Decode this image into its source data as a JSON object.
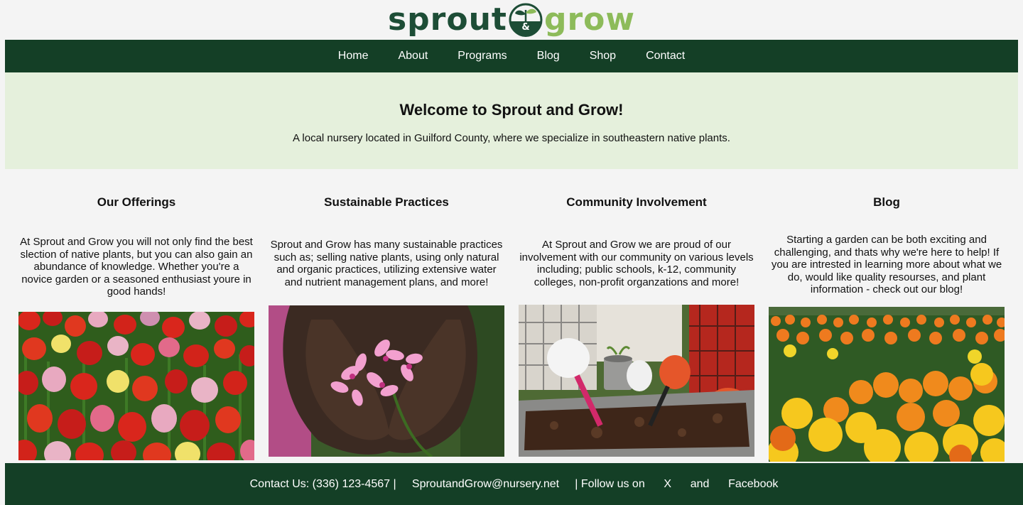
{
  "brand": {
    "name_left": "sprout",
    "name_right": "grow",
    "mark_glyph": "&",
    "primary_color": "#143f26",
    "accent_color": "#8dbb5a",
    "hero_bg": "#e5f0dc"
  },
  "nav": {
    "items": [
      {
        "label": "Home"
      },
      {
        "label": "About"
      },
      {
        "label": "Programs"
      },
      {
        "label": "Blog"
      },
      {
        "label": "Shop"
      },
      {
        "label": "Contact"
      }
    ]
  },
  "hero": {
    "title": "Welcome to Sprout and Grow!",
    "subtitle": "A local nursery located in Guilford County, where we specialize in southeastern native plants."
  },
  "columns": [
    {
      "title": "Our Offerings",
      "text": "At Sprout and Grow you will not only find the best slection of native plants, but you can also gain an abundance of knowledge. Whether you're a novice garden or a seasoned enthusiast youre in good hands!",
      "image": "red-pink-tulip-field-photo"
    },
    {
      "title": "Sustainable Practices",
      "text": "Sprout and Grow has many sustainable practices such as; selling native plants, using only natural and organic practices, utilizing extensive water and nutrient management plans, and more!",
      "image": "hands-holding-pink-geranium-photo"
    },
    {
      "title": "Community Involvement",
      "text": "At Sprout and Grow we are proud of our involvement with our community on various levels including; public schools, k-12, community colleges, non-profit organzations and more!",
      "image": "gardeners-potting-soil-photo"
    },
    {
      "title": "Blog",
      "text": "Starting a garden can be both exciting and challenging, and thats why we're here to help! If you are intrested in learning more about what we do, would like quality resourses, and plant information - check out our blog!",
      "image": "marigold-field-photo"
    }
  ],
  "footer": {
    "contact_prefix": "Contact Us: (336) 123-4567 |",
    "email": "SproutandGrow@nursery.net",
    "follow_prefix": "| Follow us on",
    "x_label": "X",
    "and_word": "and",
    "facebook_label": "Facebook"
  }
}
